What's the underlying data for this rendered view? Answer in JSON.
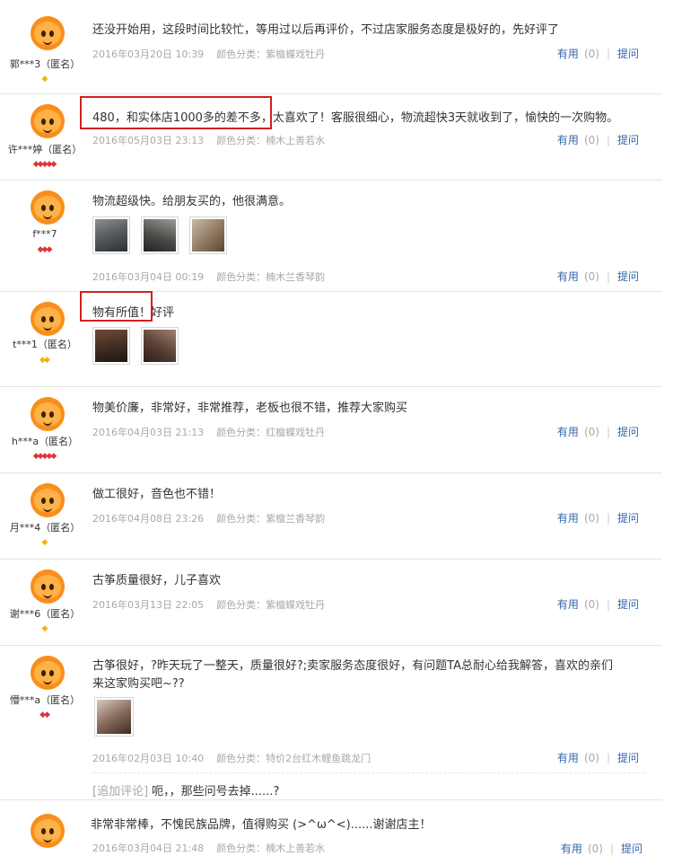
{
  "labels": {
    "useful": "有用",
    "ask": "提问",
    "category_prefix": "颜色分类："
  },
  "reviews": [
    {
      "user": "郭***3（匿名）",
      "badge": "gold1",
      "text": "还没开始用，这段时间比较忙，等用过以后再评价，不过店家服务态度是极好的，先好评了",
      "date": "2016年03月20日 10:39",
      "category": "紫檀蝶戏牡丹",
      "useful_count": "(0)"
    },
    {
      "user": "许***婷（匿名）",
      "badge": "red5",
      "text": "480，和实体店1000多的差不多，太喜欢了！客服很细心，物流超快3天就收到了，愉快的一次购物。",
      "date": "2016年05月03日 23:13",
      "category": "楠木上善若水",
      "useful_count": "(0)"
    },
    {
      "user": "f***7",
      "badge": "red3",
      "text": "物流超级快。给朋友买的，他很满意。",
      "date": "2016年03月04日 00:19",
      "category": "楠木兰香琴韵",
      "useful_count": "(0)"
    },
    {
      "user": "t***1（匿名）",
      "badge": "gold2",
      "text": "物有所值！好评"
    },
    {
      "user": "h***a（匿名）",
      "badge": "red5",
      "text": "物美价廉，非常好，非常推荐，老板也很不错，推荐大家购买",
      "date": "2016年04月03日 21:13",
      "category": "红檀蝶戏牡丹",
      "useful_count": "(0)"
    },
    {
      "user": "月***4（匿名）",
      "badge": "gold1",
      "text": "做工很好，音色也不错！",
      "date": "2016年04月08日 23:26",
      "category": "紫檀兰香琴韵",
      "useful_count": "(0)"
    },
    {
      "user": "谢***6（匿名）",
      "badge": "gold1",
      "text": "古筝质量很好，儿子喜欢",
      "date": "2016年03月13日 22:05",
      "category": "紫檀蝶戏牡丹",
      "useful_count": "(0)"
    },
    {
      "user": "懵***a（匿名）",
      "badge": "red2",
      "text": "古筝很好，?昨天玩了一整天，质量很好?;卖家服务态度很好，有问题TA总耐心给我解答，喜欢的亲们",
      "text2": "来这家购买吧~??",
      "date": "2016年02月03日 10:40",
      "category": "特价2台红木鲤鱼跳龙门",
      "useful_count": "(0)",
      "followup_tag": "[追加评论]",
      "followup": "呃，，那些问号去掉......?"
    },
    {
      "text": "非常非常棒，不愧民族品牌，值得购买 (>^ω^<)......谢谢店主！",
      "date": "2016年03月04日 21:48",
      "category": "楠木上善若水",
      "useful_count": "(0)"
    }
  ]
}
